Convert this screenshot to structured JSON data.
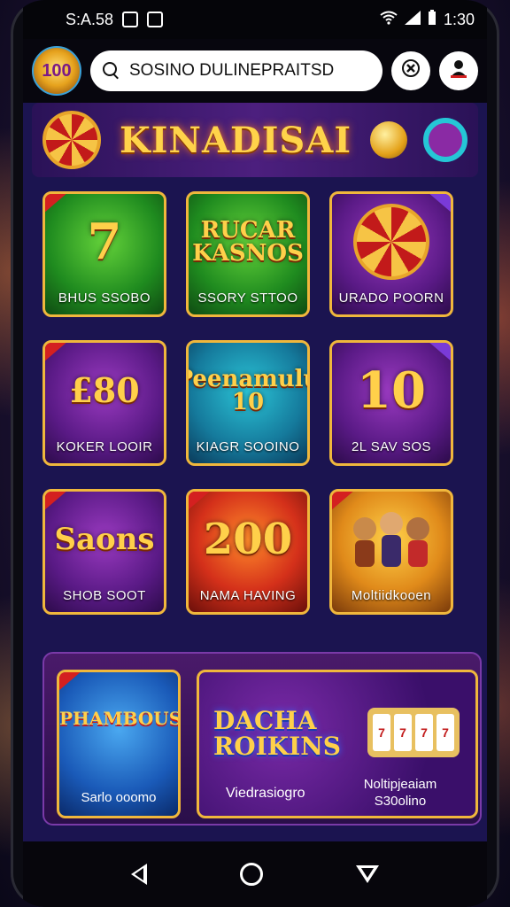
{
  "status_bar": {
    "time_left": "S:A.58",
    "time_right": "1:30"
  },
  "header": {
    "logo_text": "100",
    "search_text": "SOSINO DULINEPRAITSD"
  },
  "banner": {
    "title": "KINADISAI"
  },
  "tiles": [
    {
      "art": "7",
      "label": "BHUS SSOBO",
      "color": "green"
    },
    {
      "art": "RUCAR KASNOS",
      "label": "SSORY STTOO",
      "color": "green"
    },
    {
      "art": "",
      "label": "URADO POORN",
      "color": "purple"
    },
    {
      "art": "£80",
      "label": "KOKER LOOIR",
      "color": "purple"
    },
    {
      "art": "Peenamulu 10",
      "label": "KIAGR SOOINO",
      "color": "teal"
    },
    {
      "art": "10",
      "label": "2L SAV SOS",
      "color": "purple"
    },
    {
      "art": "Saons",
      "label": "SHOB SOOT",
      "color": "purple"
    },
    {
      "art": "200",
      "label": "NAMA HAVING",
      "color": "red"
    },
    {
      "art": "",
      "label": "Moltiidkooen",
      "color": "orange"
    }
  ],
  "featured": {
    "left": {
      "art": "PHAMBOUS",
      "label": "Sarlo ooomo"
    },
    "right": {
      "title_line1": "DACHA",
      "title_line2": "ROIKINS",
      "subtitle": "Viedrasiogro",
      "caption_line1": "Noltipjeaiam",
      "caption_line2": "S30olino"
    }
  },
  "colors": {
    "gold_border": "#f0b73c",
    "screen_bg": "#1b1450",
    "title_gold": "#ffd04a"
  },
  "icons": {
    "search": "search-icon",
    "chat": "x-chat-icon",
    "profile": "user-profile-icon",
    "back": "back-triangle-icon",
    "home": "home-circle-icon",
    "recent": "recent-triangle-icon"
  }
}
